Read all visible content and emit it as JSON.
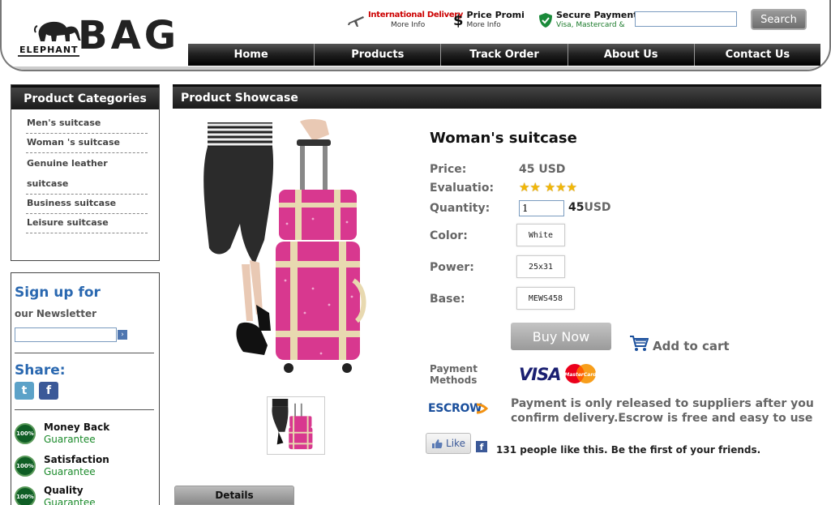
{
  "brand": {
    "small": "ELEPHANT",
    "big": "BAG"
  },
  "promos": [
    {
      "title": "International Delivery",
      "sub": "More Info",
      "icon": "plane-icon"
    },
    {
      "title": "Price Promi",
      "sub": "More Info",
      "icon": "dollar-icon"
    },
    {
      "title": "Secure Payment",
      "sub": "Visa, Mastercard & Paypal",
      "icon": "shield-icon"
    }
  ],
  "search": {
    "button": "Search",
    "value": ""
  },
  "nav": [
    "Home",
    "Products",
    "Track Order",
    "About Us",
    "Contact Us"
  ],
  "sidebar": {
    "title": "Product Categories",
    "items": [
      "Men's suitcase",
      "Woman 's suitcase",
      "Genuine leather",
      "suitcase",
      "Business suitcase",
      "Leisure suitcase"
    ]
  },
  "newsletter": {
    "heading": "Sign up for",
    "sub": "our Newsletter",
    "go": "›"
  },
  "share": {
    "heading": "Share:"
  },
  "guarantees": [
    {
      "badge": "100%",
      "title": "Money Back",
      "sub": "Guarantee"
    },
    {
      "badge": "100%",
      "title": "Satisfaction",
      "sub": "Guarantee"
    },
    {
      "badge": "100%",
      "title": "Quality",
      "sub": "Guarantee"
    }
  ],
  "showcase": {
    "title": "Product Showcase"
  },
  "product": {
    "name": "Woman's suitcase",
    "price_label": "Price:",
    "price": "45 USD",
    "eval_label": "Evaluatio:",
    "rating": 5,
    "stars": "★★ ★★★",
    "qty_label": "Quantity:",
    "qty": "1",
    "qty_total": "45",
    "qty_unit": "USD",
    "color_label": "Color:",
    "color": "White",
    "power_label": "Power:",
    "power": "25x31",
    "base_label": "Base:",
    "base": "MEWS458",
    "buy": "Buy Now",
    "cart": "Add to cart",
    "pm_label": "Payment Methods",
    "visa": "VISA",
    "mastercard": "MasterCard",
    "escrow": "ESCROW",
    "escrow_text": "Payment is only released to suppliers after you confirm delivery.Escrow is free and easy to use",
    "like": "Like",
    "like_text": "131 people like this. Be the first of your friends."
  },
  "tabs": {
    "details": "Details"
  },
  "colors": {
    "suitcase_pink": "#d8388f",
    "trim": "#e8d9b0",
    "link_blue": "#2a68b0",
    "badge_green": "#0f5e25"
  }
}
